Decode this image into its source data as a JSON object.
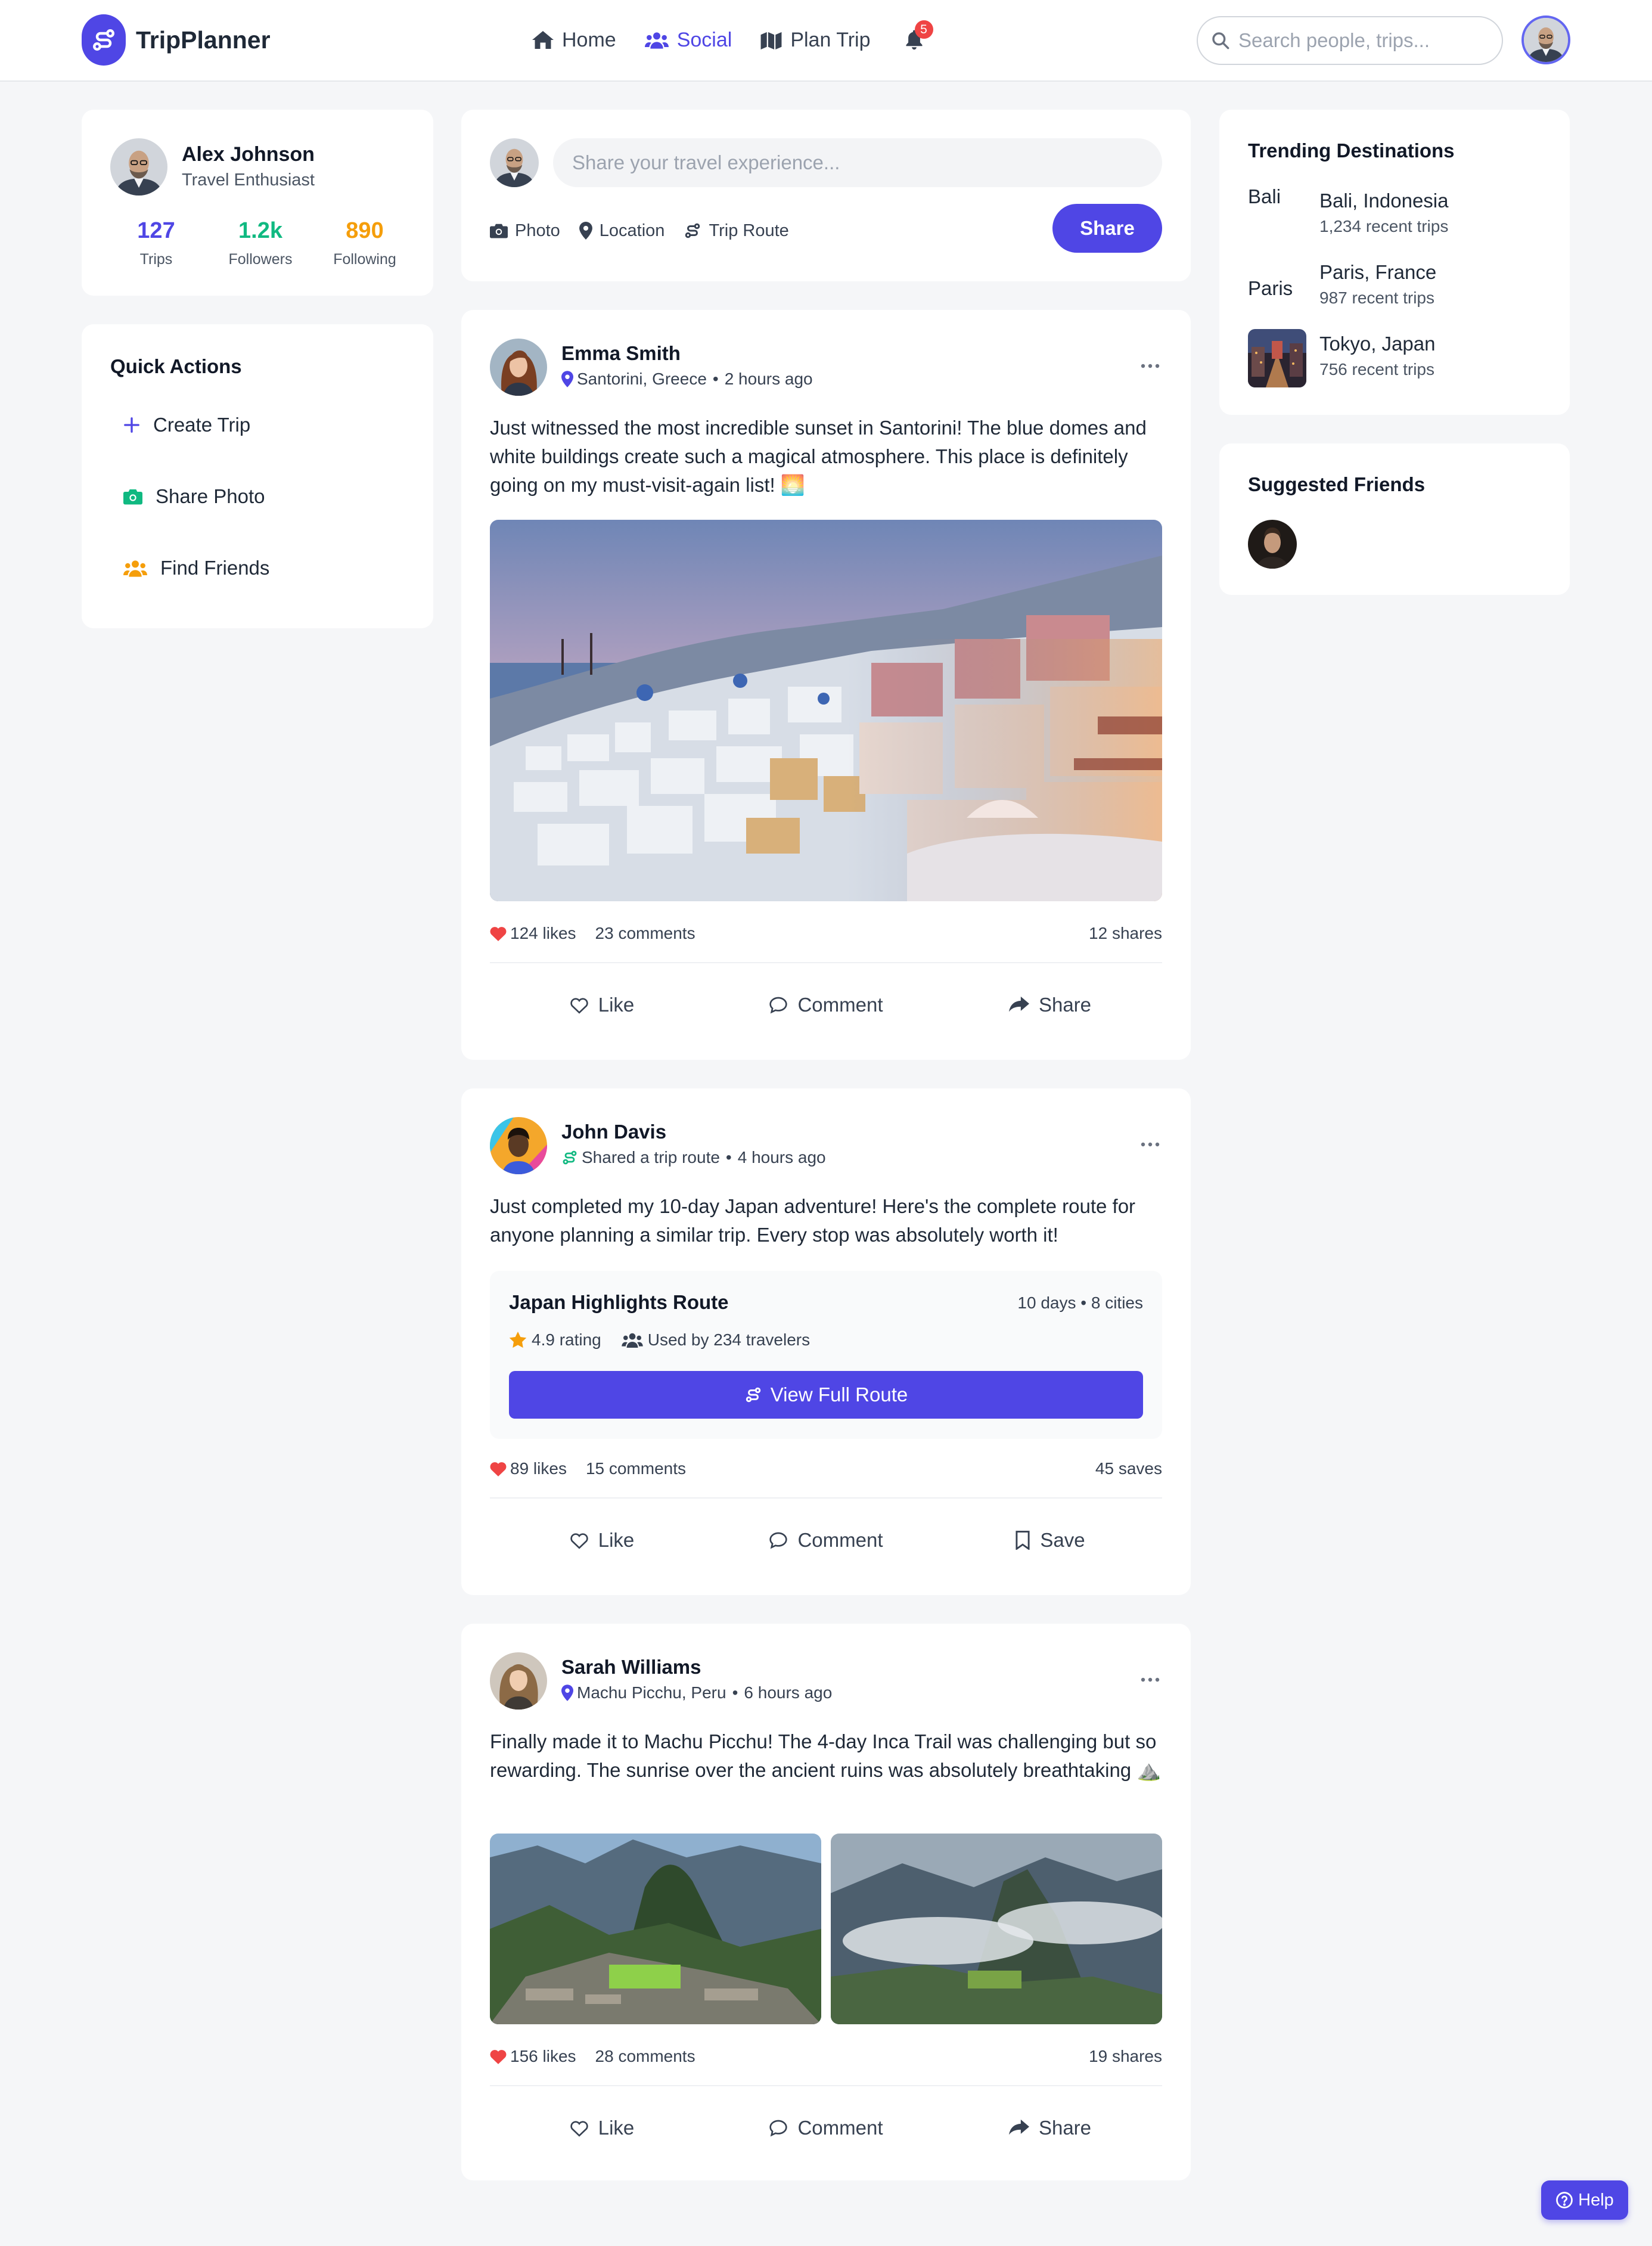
{
  "app": {
    "name": "TripPlanner"
  },
  "nav": {
    "items": [
      {
        "label": "Home",
        "icon": "home-icon",
        "active": false
      },
      {
        "label": "Social",
        "icon": "users-icon",
        "active": true
      },
      {
        "label": "Plan Trip",
        "icon": "map-icon",
        "active": false
      }
    ],
    "notifications_count": "5"
  },
  "search": {
    "placeholder": "Search people, trips..."
  },
  "profile": {
    "name": "Alex Johnson",
    "role": "Travel Enthusiast",
    "stats": [
      {
        "value": "127",
        "label": "Trips",
        "color": "#4f46e5"
      },
      {
        "value": "1.2k",
        "label": "Followers",
        "color": "#10b981"
      },
      {
        "value": "890",
        "label": "Following",
        "color": "#f59e0b"
      }
    ]
  },
  "quick_actions": {
    "title": "Quick Actions",
    "items": [
      {
        "label": "Create Trip",
        "icon": "plus-icon",
        "color": "#4f46e5"
      },
      {
        "label": "Share Photo",
        "icon": "camera-icon",
        "color": "#10b981"
      },
      {
        "label": "Find Friends",
        "icon": "users-icon",
        "color": "#f59e0b"
      }
    ]
  },
  "composer": {
    "placeholder": "Share your travel experience...",
    "tools": [
      {
        "label": "Photo",
        "icon": "camera-icon"
      },
      {
        "label": "Location",
        "icon": "map-pin-icon"
      },
      {
        "label": "Trip Route",
        "icon": "route-icon"
      }
    ],
    "share_label": "Share"
  },
  "posts": [
    {
      "author": "Emma Smith",
      "meta_label": "Santorini, Greece",
      "meta_icon": "map-pin-icon",
      "time": "2 hours ago",
      "text": "Just witnessed the most incredible sunset in Santorini! The blue domes and white buildings create such a magical atmosphere. This place is definitely going on my must-visit-again list! 🌅",
      "likes": "124 likes",
      "comments": "23 comments",
      "right_stat": "12 shares",
      "actions": [
        "Like",
        "Comment",
        "Share"
      ]
    },
    {
      "author": "John Davis",
      "meta_label": "Shared a trip route",
      "meta_icon": "route-icon",
      "time": "4 hours ago",
      "text": "Just completed my 10-day Japan adventure! Here's the complete route for anyone planning a similar trip. Every stop was absolutely worth it!",
      "route": {
        "title": "Japan Highlights Route",
        "duration": "10 days • 8 cities",
        "rating": "4.9 rating",
        "used_by": "Used by 234 travelers",
        "button_label": "View Full Route"
      },
      "likes": "89 likes",
      "comments": "15 comments",
      "right_stat": "45 saves",
      "actions": [
        "Like",
        "Comment",
        "Save"
      ]
    },
    {
      "author": "Sarah Williams",
      "meta_label": "Machu Picchu, Peru",
      "meta_icon": "map-pin-icon",
      "time": "6 hours ago",
      "text": "Finally made it to Machu Picchu! The 4-day Inca Trail was challenging but so rewarding. The sunrise over the ancient ruins was absolutely breathtaking ⛰️",
      "likes": "156 likes",
      "comments": "28 comments",
      "right_stat": "19 shares",
      "actions": [
        "Like",
        "Comment",
        "Share"
      ]
    }
  ],
  "trending": {
    "title": "Trending Destinations",
    "items": [
      {
        "name": "Bali, Indonesia",
        "count": "1,234 recent trips",
        "thumb_alt": "Bali"
      },
      {
        "name": "Paris, France",
        "count": "987 recent trips",
        "thumb_alt": "Paris"
      },
      {
        "name": "Tokyo, Japan",
        "count": "756 recent trips",
        "thumb_alt": ""
      }
    ]
  },
  "suggested": {
    "title": "Suggested Friends"
  },
  "help": {
    "label": "Help"
  },
  "colors": {
    "primary": "#4f46e5",
    "heart": "#ef4444",
    "green": "#10b981",
    "amber": "#f59e0b"
  }
}
